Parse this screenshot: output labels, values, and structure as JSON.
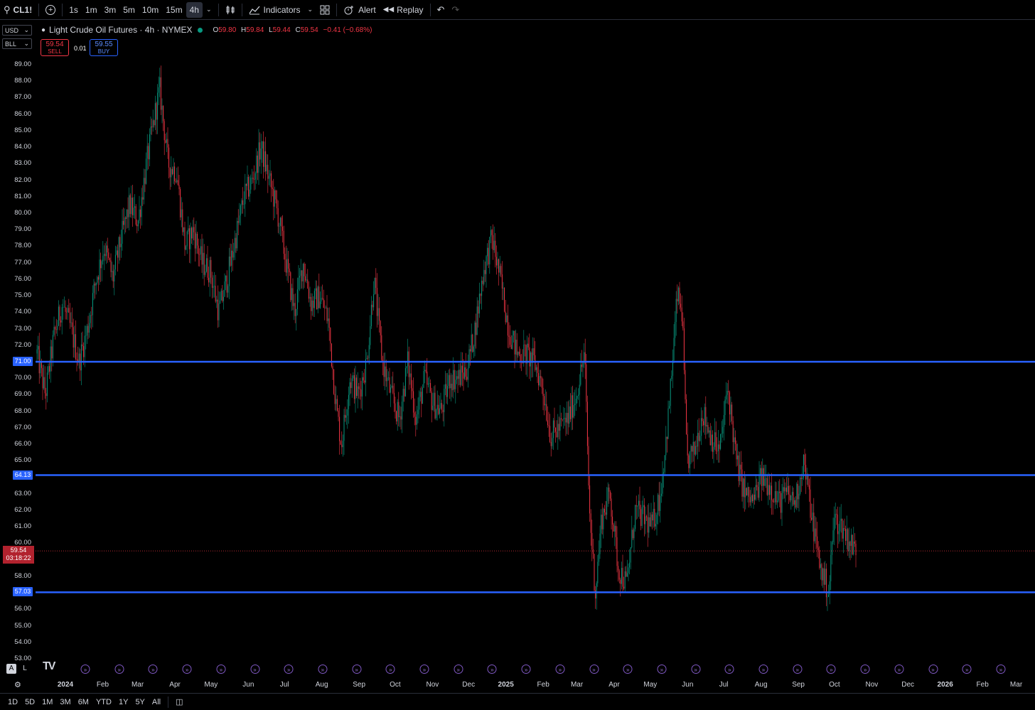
{
  "toolbar": {
    "symbol": "CL1!",
    "intervals": [
      "1s",
      "1m",
      "3m",
      "5m",
      "10m",
      "15m",
      "4h"
    ],
    "active_interval": "4h",
    "indicators_label": "Indicators",
    "alert_label": "Alert",
    "replay_label": "Replay",
    "icons": [
      "search-icon",
      "plus-circle-icon",
      "chevron-down-icon",
      "candles-icon",
      "indicators-icon",
      "layout-grid-icon",
      "alarm-icon",
      "replay-icon",
      "undo-icon",
      "redo-icon"
    ]
  },
  "scale_selectors": {
    "currency": "USD",
    "unit": "BLL"
  },
  "legend": {
    "title": "Light Crude Oil Futures · 4h · NYMEX",
    "open_k": "O",
    "open": "59.80",
    "high_k": "H",
    "high": "59.84",
    "low_k": "L",
    "low": "59.44",
    "close_k": "C",
    "close": "59.54",
    "change": "−0.41 (−0.68%)"
  },
  "trade": {
    "sell_price": "59.54",
    "sell_label": "SELL",
    "spread": "0.01",
    "buy_price": "59.55",
    "buy_label": "BUY"
  },
  "price_axis": {
    "labels": [
      "89.00",
      "88.00",
      "87.00",
      "86.00",
      "85.00",
      "84.00",
      "83.00",
      "82.00",
      "81.00",
      "80.00",
      "79.00",
      "78.00",
      "77.00",
      "76.00",
      "75.00",
      "74.00",
      "73.00",
      "72.00",
      "70.00",
      "69.00",
      "68.00",
      "67.00",
      "66.00",
      "65.00",
      "63.00",
      "62.00",
      "61.00",
      "60.00",
      "58.00",
      "56.00",
      "55.00",
      "54.00",
      "53.00"
    ],
    "current_price": "59.54",
    "countdown": "03:18:22"
  },
  "horizontal_levels": [
    {
      "label": "71.00",
      "price": 71.0
    },
    {
      "label": "64.13",
      "price": 64.13
    },
    {
      "label": "57.03",
      "price": 57.03
    }
  ],
  "time_axis": {
    "labels": [
      {
        "text": "2024",
        "year": true
      },
      {
        "text": "Feb"
      },
      {
        "text": "Mar"
      },
      {
        "text": "Apr"
      },
      {
        "text": "May"
      },
      {
        "text": "Jun"
      },
      {
        "text": "Jul"
      },
      {
        "text": "Aug"
      },
      {
        "text": "Sep"
      },
      {
        "text": "Oct"
      },
      {
        "text": "Nov"
      },
      {
        "text": "Dec"
      },
      {
        "text": "2025",
        "year": true
      },
      {
        "text": "Feb"
      },
      {
        "text": "Mar"
      },
      {
        "text": "Apr"
      },
      {
        "text": "May"
      },
      {
        "text": "Jun"
      },
      {
        "text": "Jul"
      },
      {
        "text": "Aug"
      },
      {
        "text": "Sep"
      },
      {
        "text": "Oct"
      },
      {
        "text": "Nov"
      },
      {
        "text": "Dec"
      },
      {
        "text": "2026",
        "year": true
      },
      {
        "text": "Feb"
      },
      {
        "text": "Mar"
      }
    ]
  },
  "event_markers_count": 28,
  "axis_mode": {
    "auto": "A",
    "log": "L"
  },
  "ranges": [
    "1D",
    "5D",
    "1M",
    "3M",
    "6M",
    "YTD",
    "1Y",
    "5Y",
    "All"
  ],
  "colors": {
    "up": "#089981",
    "down": "#f23645",
    "level_line": "#2962ff",
    "background": "#000000"
  },
  "chart_data": {
    "type": "candlestick",
    "ylim": [
      53,
      89
    ],
    "price_path": [
      [
        "2024-01-01",
        71.5
      ],
      [
        "2024-01-08",
        69.0
      ],
      [
        "2024-01-15",
        72.5
      ],
      [
        "2024-01-22",
        74.5
      ],
      [
        "2024-01-29",
        73.0
      ],
      [
        "2024-02-05",
        71.0
      ],
      [
        "2024-02-12",
        73.0
      ],
      [
        "2024-02-19",
        76.0
      ],
      [
        "2024-02-26",
        78.0
      ],
      [
        "2024-03-04",
        76.0
      ],
      [
        "2024-03-11",
        78.5
      ],
      [
        "2024-03-18",
        80.5
      ],
      [
        "2024-03-25",
        79.5
      ],
      [
        "2024-04-01",
        83.0
      ],
      [
        "2024-04-08",
        86.0
      ],
      [
        "2024-04-12",
        87.5
      ],
      [
        "2024-04-19",
        83.0
      ],
      [
        "2024-04-26",
        82.5
      ],
      [
        "2024-05-03",
        78.0
      ],
      [
        "2024-05-10",
        79.0
      ],
      [
        "2024-05-17",
        77.0
      ],
      [
        "2024-05-24",
        76.5
      ],
      [
        "2024-05-31",
        74.0
      ],
      [
        "2024-06-07",
        76.0
      ],
      [
        "2024-06-14",
        78.5
      ],
      [
        "2024-06-21",
        81.0
      ],
      [
        "2024-06-28",
        82.0
      ],
      [
        "2024-07-05",
        84.0
      ],
      [
        "2024-07-12",
        82.0
      ],
      [
        "2024-07-19",
        80.0
      ],
      [
        "2024-07-26",
        77.0
      ],
      [
        "2024-08-02",
        74.0
      ],
      [
        "2024-08-09",
        77.0
      ],
      [
        "2024-08-16",
        74.5
      ],
      [
        "2024-08-23",
        75.0
      ],
      [
        "2024-08-30",
        73.5
      ],
      [
        "2024-09-06",
        68.0
      ],
      [
        "2024-09-10",
        66.0
      ],
      [
        "2024-09-17",
        70.0
      ],
      [
        "2024-09-24",
        69.0
      ],
      [
        "2024-10-01",
        71.0
      ],
      [
        "2024-10-07",
        76.0
      ],
      [
        "2024-10-14",
        71.0
      ],
      [
        "2024-10-21",
        69.0
      ],
      [
        "2024-10-28",
        67.5
      ],
      [
        "2024-11-04",
        71.0
      ],
      [
        "2024-11-11",
        67.5
      ],
      [
        "2024-11-18",
        70.0
      ],
      [
        "2024-11-25",
        68.5
      ],
      [
        "2024-12-02",
        68.0
      ],
      [
        "2024-12-09",
        70.0
      ],
      [
        "2024-12-16",
        70.0
      ],
      [
        "2024-12-23",
        70.5
      ],
      [
        "2024-12-30",
        73.0
      ],
      [
        "2025-01-06",
        76.5
      ],
      [
        "2025-01-13",
        78.5
      ],
      [
        "2025-01-20",
        76.0
      ],
      [
        "2025-01-27",
        73.0
      ],
      [
        "2025-02-03",
        71.5
      ],
      [
        "2025-02-10",
        71.5
      ],
      [
        "2025-02-17",
        71.0
      ],
      [
        "2025-02-24",
        69.5
      ],
      [
        "2025-03-03",
        66.5
      ],
      [
        "2025-03-10",
        67.0
      ],
      [
        "2025-03-17",
        67.5
      ],
      [
        "2025-03-24",
        69.0
      ],
      [
        "2025-03-31",
        71.5
      ],
      [
        "2025-04-04",
        62.0
      ],
      [
        "2025-04-09",
        57.0
      ],
      [
        "2025-04-14",
        61.5
      ],
      [
        "2025-04-21",
        63.0
      ],
      [
        "2025-04-28",
        58.5
      ],
      [
        "2025-05-05",
        57.5
      ],
      [
        "2025-05-12",
        62.0
      ],
      [
        "2025-05-19",
        61.5
      ],
      [
        "2025-05-26",
        61.0
      ],
      [
        "2025-06-02",
        63.0
      ],
      [
        "2025-06-09",
        68.0
      ],
      [
        "2025-06-16",
        75.0
      ],
      [
        "2025-06-20",
        74.0
      ],
      [
        "2025-06-24",
        65.0
      ],
      [
        "2025-06-30",
        65.5
      ],
      [
        "2025-07-07",
        68.0
      ],
      [
        "2025-07-14",
        66.5
      ],
      [
        "2025-07-21",
        65.5
      ],
      [
        "2025-07-28",
        69.5
      ],
      [
        "2025-08-04",
        65.0
      ],
      [
        "2025-08-11",
        63.0
      ],
      [
        "2025-08-18",
        62.5
      ],
      [
        "2025-08-25",
        64.0
      ],
      [
        "2025-09-01",
        63.5
      ],
      [
        "2025-09-08",
        62.5
      ],
      [
        "2025-09-15",
        63.0
      ],
      [
        "2025-09-22",
        62.5
      ],
      [
        "2025-09-29",
        65.0
      ],
      [
        "2025-10-06",
        61.5
      ],
      [
        "2025-10-13",
        58.5
      ],
      [
        "2025-10-20",
        57.0
      ],
      [
        "2025-10-24",
        61.5
      ],
      [
        "2025-10-31",
        61.0
      ],
      [
        "2025-11-07",
        60.0
      ],
      [
        "2025-11-12",
        59.5
      ]
    ]
  }
}
